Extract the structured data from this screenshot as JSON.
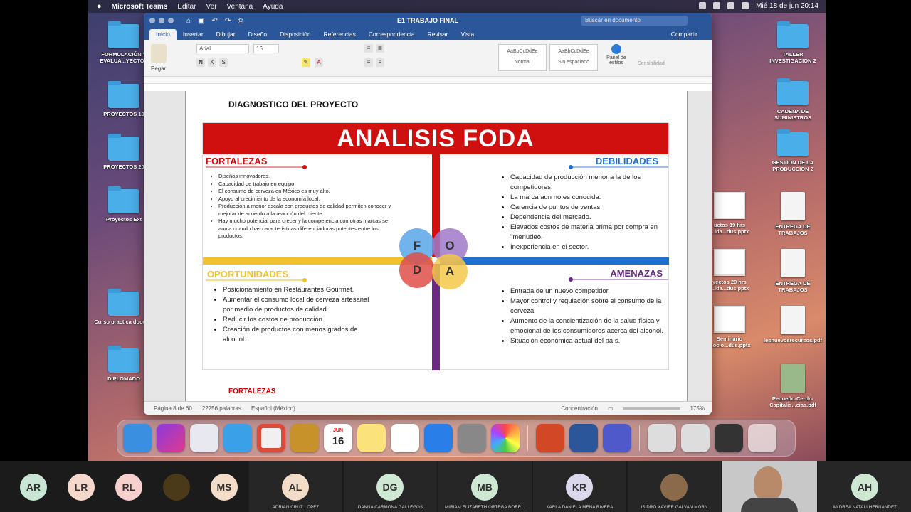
{
  "menubar": {
    "apple": "",
    "app": "Microsoft Teams",
    "items": [
      "Editar",
      "Ver",
      "Ventana",
      "Ayuda"
    ],
    "clock": "Mié 18 de jun  20:14"
  },
  "desktop": {
    "left_icons": [
      {
        "label": "FORMULACIÓN Y EVALUA...YECTOS"
      },
      {
        "label": "PROYECTOS 10"
      },
      {
        "label": "PROYECTOS 20"
      },
      {
        "label": "Proyectos Ext"
      },
      {
        "label": "Curso practica docente"
      },
      {
        "label": "DIPLOMADO"
      }
    ],
    "right_icons": [
      {
        "label": "TALLER INVESTIGACION 2"
      },
      {
        "label": "CADENA DE SUMINISTROS"
      },
      {
        "label": "GESTION DE LA PRODUCCION 2"
      },
      {
        "label": "ENTREGA DE TRABAJOS"
      },
      {
        "label": "ENTREGA DE TRABAJOS"
      },
      {
        "label": "lesnuevosrecursos.pdf"
      },
      {
        "label": "Pequeño-Cerdo-Capitalis...cias.pdf"
      }
    ],
    "mid_icons": [
      {
        "label": "uctos 19 hrs ...ida...dus.pptx"
      },
      {
        "label": "yectos 20 hrs ...ida...dus.pptx"
      },
      {
        "label": "Seminario ...ocio...dus.pptx"
      }
    ]
  },
  "word": {
    "title": "E1 TRABAJO FINAL",
    "search_placeholder": "Buscar en documento",
    "tabs": [
      "Inicio",
      "Insertar",
      "Dibujar",
      "Diseño",
      "Disposición",
      "Referencias",
      "Correspondencia",
      "Revisar",
      "Vista"
    ],
    "share": "Compartir",
    "font": "Arial",
    "font_size": "16",
    "style1": "Normal",
    "style2": "Sin espaciado",
    "style_sample": "AaBbCcDdEe",
    "panel_label": "Panel de estilos",
    "paste_label": "Pegar",
    "sensitivity": "Sensibilidad",
    "status_page": "Página 8 de 60",
    "status_words": "22256 palabras",
    "status_lang": "Español (México)",
    "status_focus": "Concentración",
    "zoom": "175%"
  },
  "document": {
    "heading": "DIAGNOSTICO DEL PROYECTO",
    "footer_heading": "FORTALEZAS",
    "banner": "ANALISIS FODA",
    "fortalezas": {
      "title": "FORTALEZAS",
      "items": [
        "Diseños innovadores.",
        "Capacidad de trabajo en equipo.",
        "El consumo de cerveza en México es muy alto.",
        "Apoyo al crecimiento de la economía local.",
        "Producción a menor escala con productos de calidad permiten conocer y mejorar de acuerdo a la reacción del cliente.",
        "Hay mucho potencial para crecer y la competencia con otras marcas se anula cuando has características diferenciadoras potentes entre los productos."
      ]
    },
    "debilidades": {
      "title": "DEBILIDADES",
      "items": [
        "Capacidad de producción menor a la de los competidores.",
        "La marca aun no es conocida.",
        "Carencia de puntos de ventas.",
        "Dependencia del mercado.",
        "Elevados costos de materia prima por compra en \"menudeo.",
        "Inexperiencia en el sector."
      ]
    },
    "oportunidades": {
      "title": "OPORTUNIDADES",
      "items": [
        "Posicionamiento en Restaurantes Gourmet.",
        "Aumentar el consumo local de cerveza artesanal por medio de productos de calidad.",
        "Reducir los costos de producción.",
        "Creación de productos con menos grados de alcohol."
      ]
    },
    "amenazas": {
      "title": "AMENAZAS",
      "items": [
        "Entrada de un nuevo competidor.",
        "Mayor control y regulación sobre el consumo de la cerveza.",
        "Aumento de la concientización de la salud física y emocional de los consumidores acerca del alcohol.",
        "Situación económica actual del país."
      ]
    },
    "letters": {
      "f": "F",
      "o": "O",
      "d": "D",
      "a": "A"
    },
    "colors": {
      "red": "#d00f0f",
      "blue": "#1e6fd0",
      "yellow": "#f2c12e",
      "purple": "#6a2a84"
    }
  },
  "dock": {
    "apps": [
      "finder-icon",
      "siri-icon",
      "launchpad-icon",
      "safari-icon",
      "chrome-icon",
      "app-icon",
      "calendar-icon",
      "notes-icon",
      "reminders-icon",
      "appstore-icon",
      "settings-icon",
      "photos-icon",
      "powerpoint-icon",
      "word-icon",
      "teams-icon"
    ],
    "calendar_month": "JUN",
    "calendar_day": "16"
  },
  "participants": [
    {
      "initials": "AR",
      "name": ""
    },
    {
      "initials": "LR",
      "name": ""
    },
    {
      "initials": "RL",
      "name": ""
    },
    {
      "initials": "",
      "name": ""
    },
    {
      "initials": "MS",
      "name": ""
    },
    {
      "initials": "AL",
      "name": "ADRIAN CRUZ LOPEZ"
    },
    {
      "initials": "DG",
      "name": "DANNA CARMONA GALLEGOS"
    },
    {
      "initials": "MB",
      "name": "MIRIAM ELIZABETH ORTEGA BORR..."
    },
    {
      "initials": "KR",
      "name": "KARLA DANIELA MENA RIVERA"
    },
    {
      "initials": "",
      "name": "ISIDRO XAVIER GALVAN MORN"
    },
    {
      "initials": "",
      "name": ""
    },
    {
      "initials": "AH",
      "name": "ANDREA NATALI HERNANDEZ"
    }
  ]
}
